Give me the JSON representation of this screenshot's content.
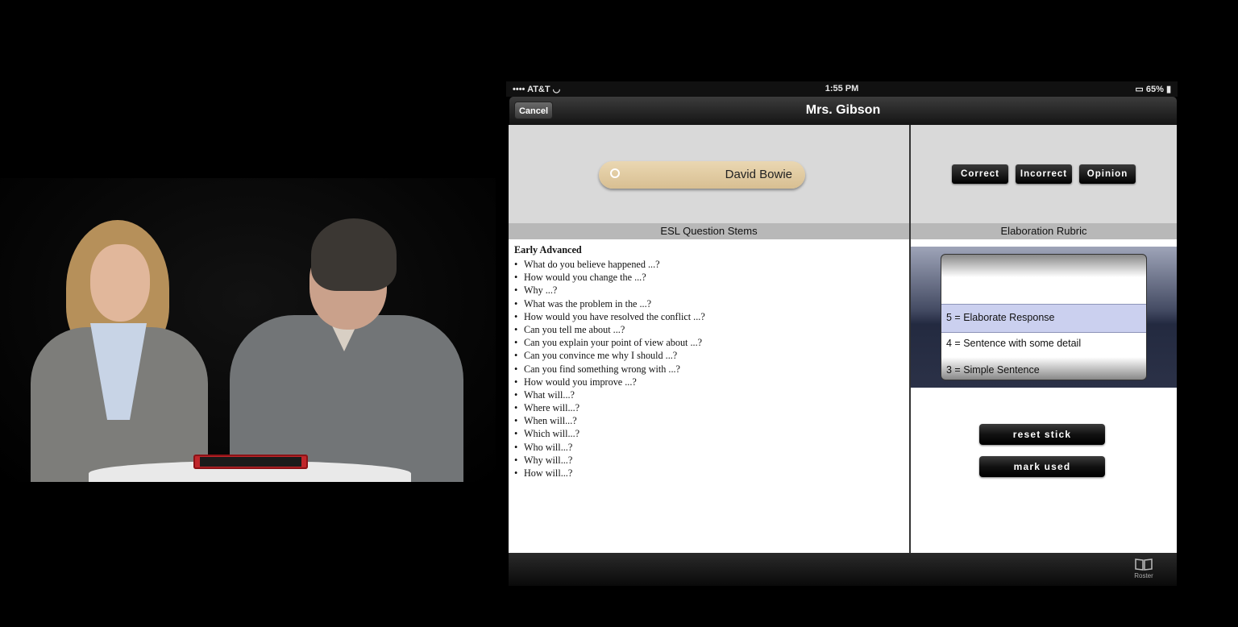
{
  "status_bar": {
    "carrier": "AT&T",
    "time": "1:55 PM",
    "battery": "65%"
  },
  "nav": {
    "cancel_label": "Cancel",
    "title": "Mrs. Gibson"
  },
  "stick": {
    "student_name": "David Bowie"
  },
  "response_buttons": [
    "Correct",
    "Incorrect",
    "Opinion"
  ],
  "left_section": {
    "header": "ESL Question Stems",
    "level": "Early Advanced",
    "stems": [
      "What do you believe happened ...?",
      "How would you change the ...?",
      "Why ...?",
      "What was the problem in the ...?",
      "How would you have resolved the conflict ...?",
      "Can you tell me about ...?",
      "Can you explain your point of view about ...?",
      "Can you convince me why I should ...?",
      "Can you find something wrong with ...?",
      "How would you improve ...?",
      "What will...?",
      "Where will...?",
      "When will...?",
      "Which will...?",
      "Who will...?",
      "Why will...?",
      "How will...?"
    ]
  },
  "right_section": {
    "header": "Elaboration Rubric",
    "picker_options": [
      "5 = Elaborate Response",
      "4 = Sentence with some detail",
      "3 = Simple Sentence"
    ],
    "selected_option": "5 = Elaborate Response",
    "reset_label": "reset stick",
    "mark_used_label": "mark used"
  },
  "tabbar": {
    "roster_label": "Roster",
    "icon": "book-icon"
  },
  "colors": {
    "wood": "#e2cda3",
    "tab_dark": "#111111",
    "header_gray": "#b8b8b8"
  }
}
